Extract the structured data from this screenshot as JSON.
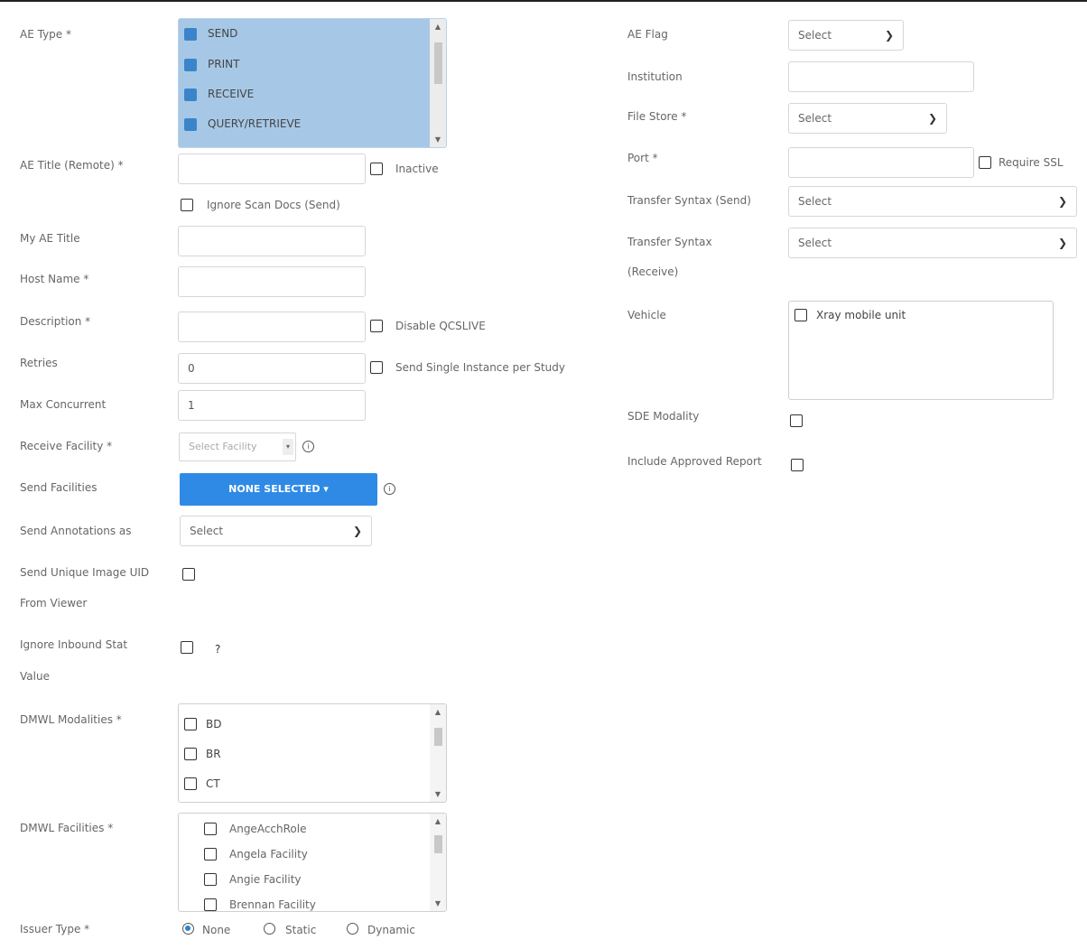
{
  "left": {
    "ae_type": {
      "label": "AE Type *",
      "options": [
        {
          "label": "SEND",
          "checked": true
        },
        {
          "label": "PRINT",
          "checked": true
        },
        {
          "label": "RECEIVE",
          "checked": true
        },
        {
          "label": "QUERY/RETRIEVE",
          "checked": true
        }
      ]
    },
    "ae_title_remote": {
      "label": "AE Title (Remote) *",
      "value": ""
    },
    "inactive_label": "Inactive",
    "ignore_scan_docs_label": "Ignore Scan Docs (Send)",
    "my_ae_title": {
      "label": "My AE Title",
      "value": ""
    },
    "host_name": {
      "label": "Host Name *",
      "value": ""
    },
    "description": {
      "label": "Description *",
      "value": ""
    },
    "disable_qcslive_label": "Disable QCSLIVE",
    "retries": {
      "label": "Retries",
      "value": "0"
    },
    "send_single_instance_label": "Send Single Instance per Study",
    "max_concurrent": {
      "label": "Max Concurrent",
      "value": "1"
    },
    "receive_facility": {
      "label": "Receive Facility *",
      "placeholder": "Select Facility"
    },
    "send_facilities": {
      "label": "Send Facilities",
      "button": "NONE SELECTED ▾"
    },
    "send_annotations": {
      "label": "Send Annotations as",
      "value": "Select"
    },
    "send_unique_uid": {
      "label_line1": "Send Unique Image UID",
      "label_line2": "From Viewer"
    },
    "ignore_inbound": {
      "label_line1": "Ignore Inbound Stat",
      "label_line2": "Value",
      "help": "?"
    },
    "dmwl_modalities": {
      "label": "DMWL Modalities *",
      "options": [
        "BD",
        "BR",
        "CT"
      ]
    },
    "dmwl_facilities": {
      "label": "DMWL Facilities *",
      "options": [
        "AngeAcchRole",
        "Angela Facility",
        "Angie Facility",
        "Brennan Facility"
      ]
    },
    "issuer_type": {
      "label": "Issuer Type *",
      "options": [
        {
          "label": "None",
          "selected": true
        },
        {
          "label": "Static",
          "selected": false
        },
        {
          "label": "Dynamic",
          "selected": false
        }
      ]
    }
  },
  "right": {
    "ae_flag": {
      "label": "AE Flag",
      "value": "Select"
    },
    "institution": {
      "label": "Institution",
      "value": ""
    },
    "file_store": {
      "label": "File Store *",
      "value": "Select"
    },
    "port": {
      "label": "Port *",
      "value": ""
    },
    "require_ssl_label": "Require SSL",
    "transfer_syntax_send": {
      "label": "Transfer Syntax (Send)",
      "value": "Select"
    },
    "transfer_syntax_receive": {
      "label_line1": "Transfer Syntax",
      "label_line2": "(Receive)",
      "value": "Select"
    },
    "vehicle": {
      "label": "Vehicle",
      "options": [
        "Xray mobile unit"
      ]
    },
    "sde_modality": {
      "label": "SDE Modality"
    },
    "include_approved_report": {
      "label": "Include Approved Report"
    }
  },
  "colors": {
    "accent": "#2f8ae6",
    "listbox_selected": "#a6c8e6",
    "checkbox_on": "#3a85c9"
  }
}
